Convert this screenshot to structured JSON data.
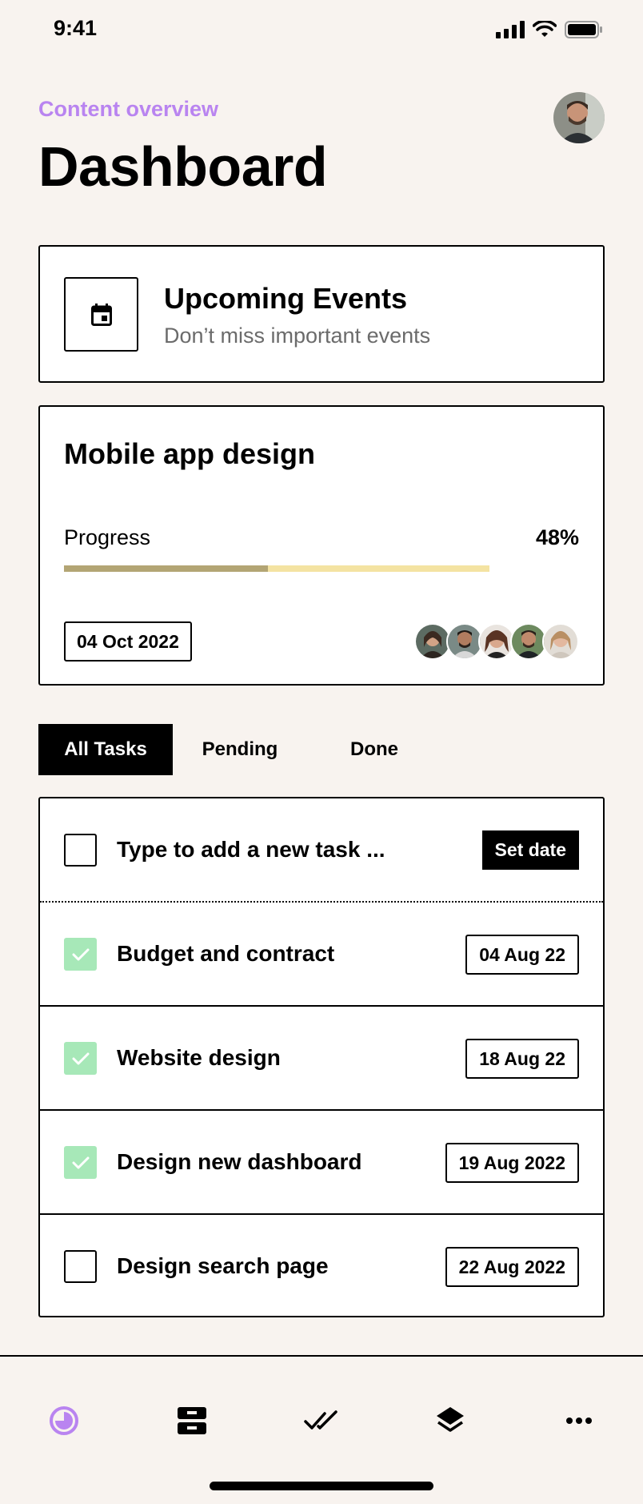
{
  "status_bar": {
    "time": "9:41"
  },
  "header": {
    "subtitle": "Content overview",
    "title": "Dashboard"
  },
  "colors": {
    "accent": "#b984f0",
    "check": "#a7e8b8",
    "progress_fill": "#b3a574",
    "progress_track": "#f4e3a2",
    "background": "#f8f3ef"
  },
  "events_card": {
    "icon": "calendar-icon",
    "title": "Upcoming Events",
    "subtitle": "Don’t miss important events"
  },
  "project_card": {
    "title": "Mobile app design",
    "progress_label": "Progress",
    "progress_value": "48%",
    "progress_fraction": 0.48,
    "date": "04 Oct 2022",
    "team_count": 5
  },
  "tabs": [
    {
      "label": "All Tasks",
      "active": true
    },
    {
      "label": "Pending",
      "active": false
    },
    {
      "label": "Done",
      "active": false
    }
  ],
  "new_task": {
    "placeholder": "Type to add a new task ...",
    "button": "Set date"
  },
  "tasks": [
    {
      "label": "Budget and contract",
      "date": "04 Aug 22",
      "done": true
    },
    {
      "label": "Website design",
      "date": "18 Aug 22",
      "done": true
    },
    {
      "label": "Design new dashboard",
      "date": "19 Aug 2022",
      "done": true
    },
    {
      "label": "Design search page",
      "date": "22 Aug 2022",
      "done": false
    }
  ],
  "bottom_nav": [
    {
      "icon": "pie-chart-icon",
      "active": true
    },
    {
      "icon": "inbox-icon",
      "active": false
    },
    {
      "icon": "double-check-icon",
      "active": false
    },
    {
      "icon": "layers-icon",
      "active": false
    },
    {
      "icon": "more-icon",
      "active": false
    }
  ]
}
